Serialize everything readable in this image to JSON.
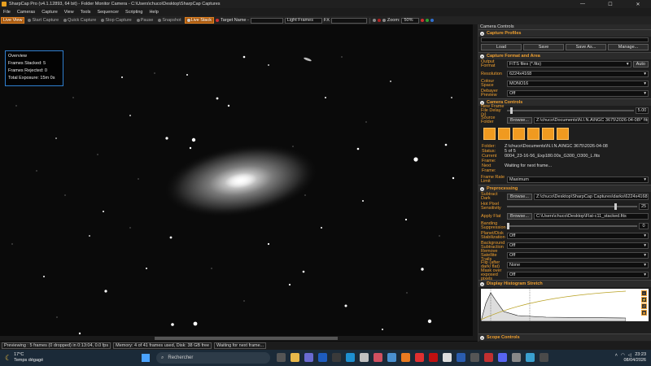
{
  "titlebar": {
    "title": "SharpCap Pro (v4.1.12893, 64 bit) - Folder Monitor Camera - C:\\Users\\chuco\\Desktop\\SharpCap Captures",
    "minimize": "—",
    "maximize": "☐",
    "close": "✕"
  },
  "menu": [
    "File",
    "Cameras",
    "Capture",
    "View",
    "Tools",
    "Sequencer",
    "Scripting",
    "Help"
  ],
  "toolbar": {
    "live_view": "Live View",
    "start_capture": "Start Capture",
    "quick_capture": "Quick Capture",
    "stop_capture": "Stop Capture",
    "pause": "Pause",
    "snapshot": "Snapshot",
    "live_stack": "Live Stack",
    "target_name_label": "Target Name -",
    "target_name_value": "",
    "frame_type": "Light Frames",
    "fx_label": "FX",
    "fx_value": "",
    "zoom_label": "Zoom:",
    "zoom_value": "50%"
  },
  "overview": {
    "title": "Overview",
    "stacked": "Frames Stacked: 5",
    "rejected": "Frames Rejected: 0",
    "exposure": "Total Exposure:     15m 0s"
  },
  "status": {
    "previewing": "Previewing : 5 frames (0 dropped) in 0:13:04, 0.0 fps",
    "memory": "Memory: 4 of 41 frames used, Disk: 38 GB free",
    "waiting": "Waiting for next frame..."
  },
  "panel": {
    "title": "Camera Controls",
    "capture_profiles": {
      "header": "Capture Profiles",
      "load": "Load",
      "save": "Save",
      "save_as": "Save As...",
      "manage": "Manage..."
    },
    "format": {
      "header": "Capture Format and Area",
      "output_format_label": "Output Format",
      "output_format": "FITS files (*.fits)",
      "auto": "Auto",
      "resolution_label": "Resolution",
      "resolution": "6224x4168",
      "colour_label": "Colour Space",
      "colour": "MONO16",
      "debayer_label": "Debayer Preview",
      "debayer": "Off"
    },
    "camera": {
      "header": "Camera Controls",
      "new_frame_label": "New Frame File Delay (s)",
      "new_frame_value": "5.00",
      "source_label": "Source Folder",
      "browse": "Browse...",
      "source_path": "Z:\\chuco\\Documents\\N.I.N.A\\NGC 3675\\2026-04-08\\* fits",
      "folder_k": "Folder:",
      "folder_v": "Z:\\chuco\\Documents\\N.I.N.A\\NGC 3675\\2026-04-08",
      "status_k": "Status:",
      "status_v": "5 of 5",
      "current_k": "Current Frame:",
      "current_v": "0004_23-16-56_Exp180.00s_G300_O300_L.fits",
      "next_k": "Next Frame:",
      "next_v": "Waiting for next frame...",
      "fps_label": "Frame Rate Limit",
      "fps_value": "Maximum"
    },
    "preproc": {
      "header": "Preprocessing",
      "dark_label": "Subtract Dark",
      "dark_browse": "Browse...",
      "dark_path": "Z:\\chuco\\Desktop\\SharpCap Captures\\darks\\6224x4168...",
      "hot_label": "Hot Pixel Sensitivity",
      "hot_value": "25",
      "flat_label": "Apply Flat",
      "flat_browse": "Browse...",
      "flat_path": "C:\\Users\\chuco\\Desktop\\Flat-c11_stacked.fits",
      "banding_label": "Banding Suppression",
      "banding_value": "0",
      "planet_label": "Planet/Disk Stabilization",
      "planet_value": "Off",
      "bg_label": "Background Subtraction",
      "bg_value": "Off",
      "sat_label": "Remove Satellite Trails",
      "sat_value": "Off",
      "flip_label": "Flip (after dark/ flat)",
      "flip_value": "None",
      "mask_label": "Mask over exposed pixels",
      "mask_value": "Off"
    },
    "histogram": {
      "header": "Display Histogram Stretch"
    },
    "scope": {
      "header": "Scope Controls"
    }
  },
  "taskbar": {
    "temp": "17°C",
    "weather": "Temps dégagé",
    "search": "Rechercher",
    "time": "23:23",
    "date": "08/04/2026"
  },
  "colors": {
    "accent": "#f0a030",
    "overview_border": "#2f7fd0",
    "taskbar": "#1b2a38"
  }
}
